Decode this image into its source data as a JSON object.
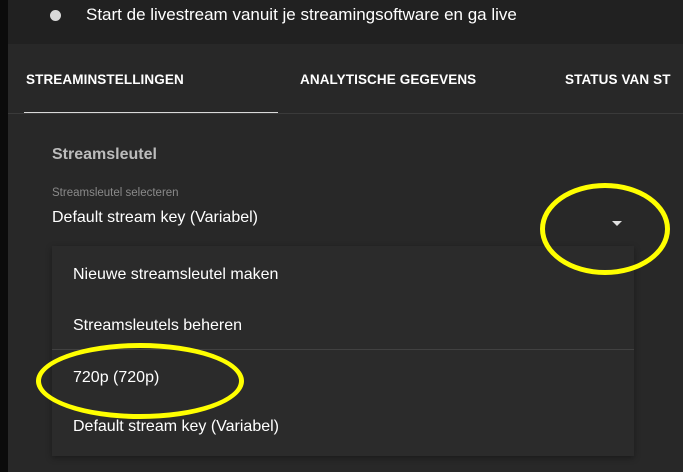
{
  "header": {
    "step_text": "Start de livestream vanuit je streamingsoftware en ga live",
    "step_icon": "bullet-dot-icon"
  },
  "tabs": [
    {
      "label": "STREAMINSTELLINGEN",
      "active": true
    },
    {
      "label": "ANALYTISCHE GEGEVENS",
      "active": false
    },
    {
      "label": "STATUS VAN ST",
      "active": false
    }
  ],
  "stream_key": {
    "section_title": "Streamsleutel",
    "field_label": "Streamsleutel selecteren",
    "selected_value": "Default stream key (Variabel)",
    "dropdown_icon": "caret-down-icon"
  },
  "dropdown_menu": {
    "items": [
      {
        "label": "Nieuwe streamsleutel maken"
      },
      {
        "label": "Streamsleutels beheren"
      },
      {
        "label": "720p (720p)"
      },
      {
        "label": "Default stream key (Variabel)"
      }
    ]
  },
  "colors": {
    "background": "#282828",
    "header_bar": "#212121",
    "menu_background": "#2b2b2b",
    "annotation": "#ffff00",
    "text_primary": "#ffffff",
    "text_secondary": "#bcbcbc"
  }
}
